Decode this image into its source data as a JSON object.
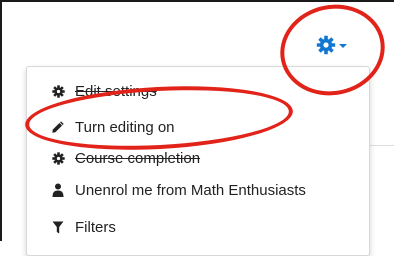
{
  "settings_button": {
    "icon": "gear-icon",
    "caret": "caret-down-icon",
    "color": "#1177d1"
  },
  "menu": {
    "items": [
      {
        "label": "Edit settings",
        "icon": "gear-icon"
      },
      {
        "label": "Turn editing on",
        "icon": "pencil-icon"
      },
      {
        "label": "Course completion",
        "icon": "gear-icon"
      },
      {
        "label": "Unenrol me from Math Enthusiasts",
        "icon": "user-icon"
      },
      {
        "label": "Filters",
        "icon": "filter-icon"
      }
    ]
  },
  "annotations": {
    "highlight_color": "#e2231a"
  }
}
